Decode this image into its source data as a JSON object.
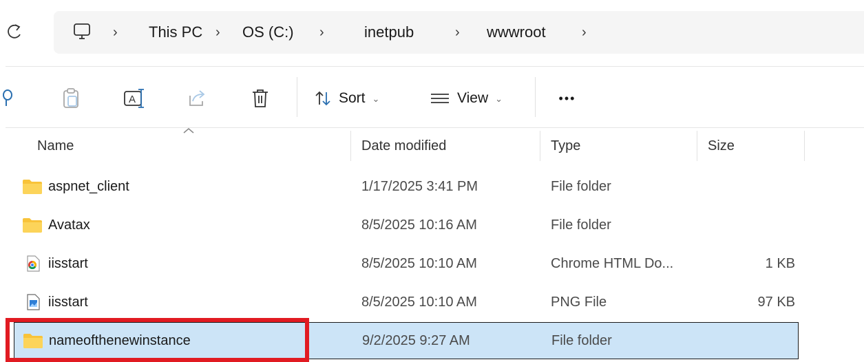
{
  "address_bar": {
    "breadcrumbs": [
      "This PC",
      "OS (C:)",
      "inetpub",
      "wwwroot"
    ]
  },
  "icons": {
    "refresh": "refresh-icon",
    "this_pc": "computer-icon",
    "chevron": "chevron-right-icon",
    "cut": "cut-icon",
    "copy": "copy-icon",
    "rename": "rename-icon",
    "share": "share-icon",
    "delete": "trash-icon",
    "sort": "sort-icon",
    "view": "view-lines-icon",
    "more": "more-icon",
    "folder": "folder-icon",
    "chrome_html": "chrome-html-icon",
    "png": "png-image-icon"
  },
  "command_bar": {
    "sort_label": "Sort",
    "view_label": "View",
    "more_label": "•••"
  },
  "columns": {
    "name": "Name",
    "date_modified": "Date modified",
    "type": "Type",
    "size": "Size",
    "sorted_by": "name"
  },
  "files": [
    {
      "name": "aspnet_client",
      "date": "1/17/2025 3:41 PM",
      "type": "File folder",
      "size": "",
      "icon": "folder"
    },
    {
      "name": "Avatax",
      "date": "8/5/2025 10:16 AM",
      "type": "File folder",
      "size": "",
      "icon": "folder"
    },
    {
      "name": "iisstart",
      "date": "8/5/2025 10:10 AM",
      "type": "Chrome HTML Do...",
      "size": "1 KB",
      "icon": "chrome_html"
    },
    {
      "name": "iisstart",
      "date": "8/5/2025 10:10 AM",
      "type": "PNG File",
      "size": "97 KB",
      "icon": "png"
    },
    {
      "name": "nameofthenewinstance",
      "date": "9/2/2025 9:27 AM",
      "type": "File folder",
      "size": "",
      "icon": "folder",
      "selected": true
    }
  ],
  "colors": {
    "selection_fill": "#cce4f7",
    "highlight_box": "#e11b22",
    "folder_yellow": "#f8c33a"
  }
}
